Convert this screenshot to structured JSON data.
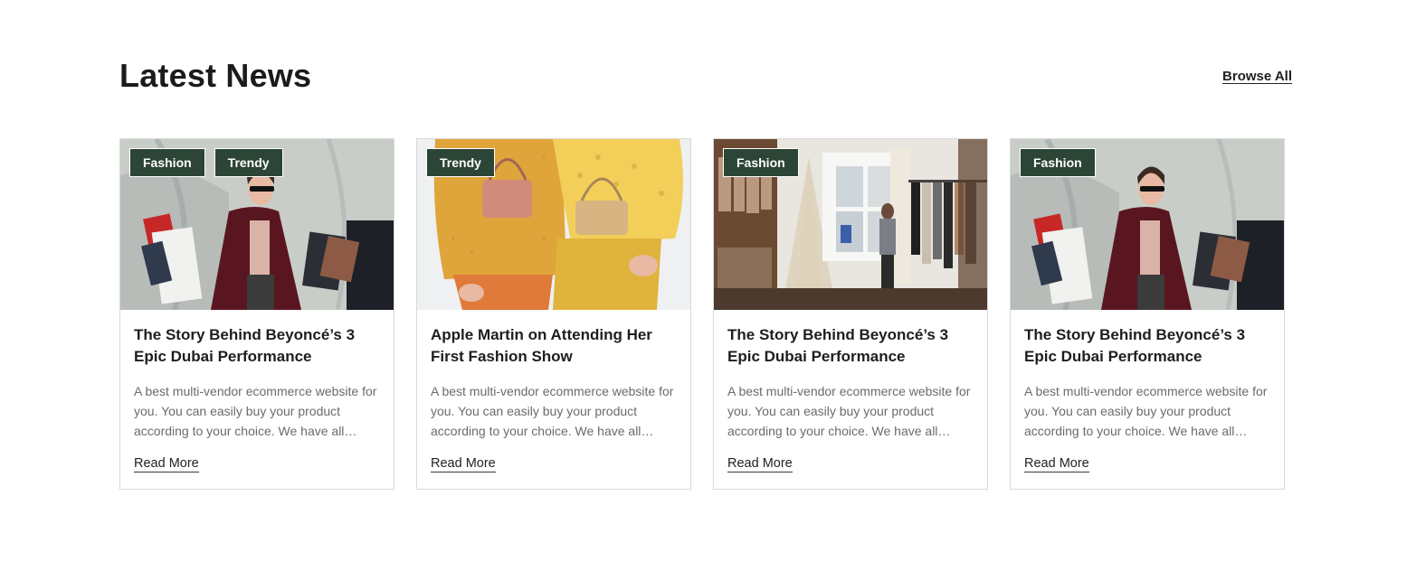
{
  "header": {
    "title": "Latest News",
    "browse_all": "Browse All"
  },
  "colors": {
    "tag_background": "#2c4536",
    "text_dark": "#1e1e1e",
    "text_muted": "#6b6b6b",
    "border": "#d9d9d9"
  },
  "cards": [
    {
      "image": "woman-with-shopping-bags-photo",
      "tags": [
        "Fashion",
        "Trendy"
      ],
      "title": "The Story Behind Beyoncé’s 3 Epic Dubai Performance",
      "excerpt": "A best multi-vendor ecommerce website for you. You can easily buy your product according to your choice. We have all…",
      "read_more": "Read More"
    },
    {
      "image": "two-women-yellow-outfits-bags-photo",
      "tags": [
        "Trendy"
      ],
      "title": "Apple Martin on Attending Her First Fashion Show",
      "excerpt": "A best multi-vendor ecommerce website for you. You can easily buy your product according to your choice. We have all…",
      "read_more": "Read More"
    },
    {
      "image": "clothing-boutique-interior-photo",
      "tags": [
        "Fashion"
      ],
      "title": "The Story Behind Beyoncé’s 3 Epic Dubai Performance",
      "excerpt": "A best multi-vendor ecommerce website for you. You can easily buy your product according to your choice. We have all…",
      "read_more": "Read More"
    },
    {
      "image": "woman-with-shopping-bags-photo",
      "tags": [
        "Fashion"
      ],
      "title": "The Story Behind Beyoncé’s 3 Epic Dubai Performance",
      "excerpt": "A best multi-vendor ecommerce website for you. You can easily buy your product according to your choice. We have all…",
      "read_more": "Read More"
    }
  ]
}
